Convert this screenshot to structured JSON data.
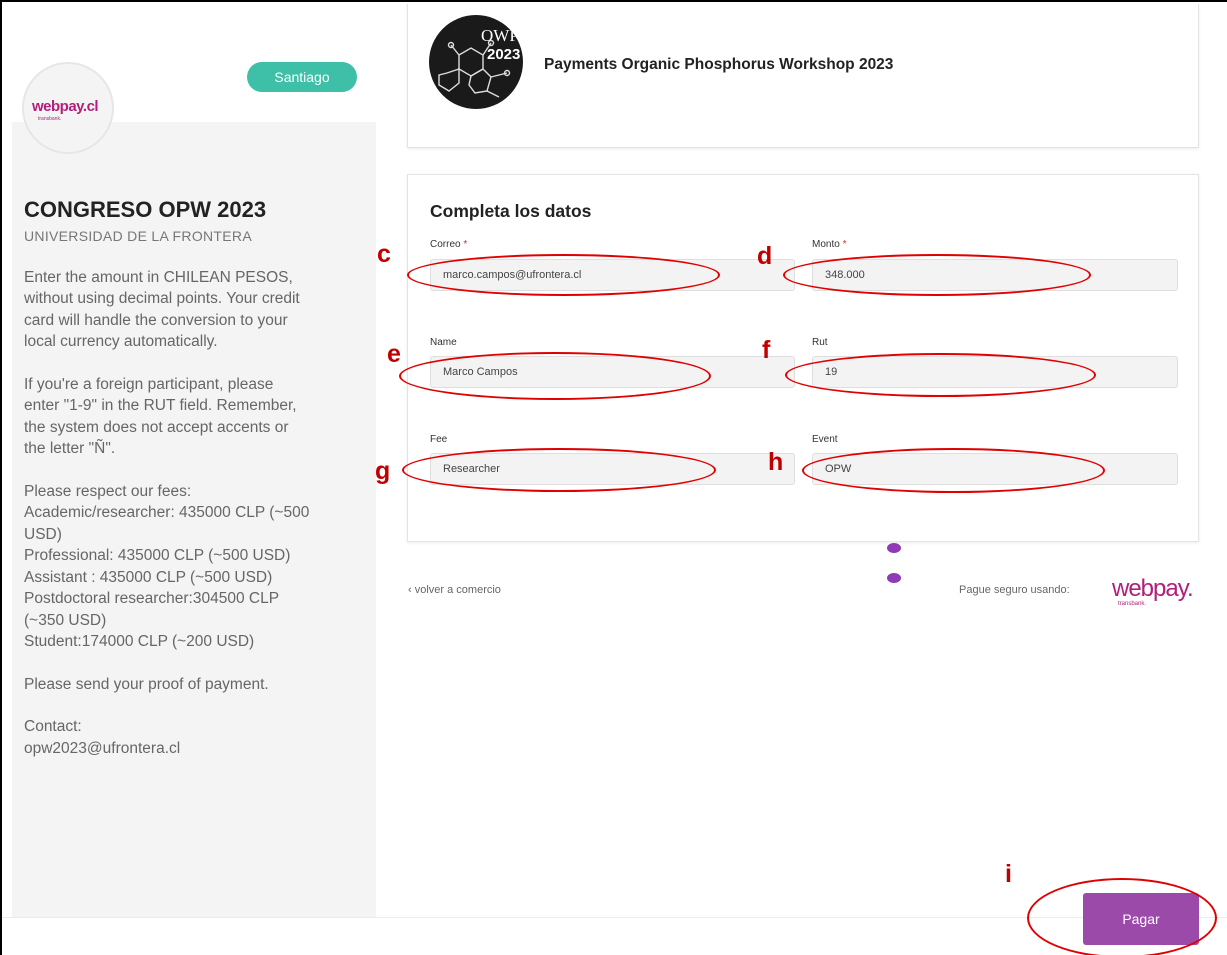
{
  "sidebar": {
    "logo_text": "webpay.cl",
    "logo_subtext": "transbank.",
    "city_badge": "Santiago",
    "title": "CONGRESO OPW 2023",
    "subtitle": "UNIVERSIDAD DE LA FRONTERA",
    "paragraph1": [
      "Enter the amount in CHILEAN PESOS,",
      "without using decimal points. Your credit",
      "card will handle the conversion to your",
      "local currency automatically."
    ],
    "paragraph2": [
      "If you're a foreign participant, please",
      "enter \"1-9\" in the RUT field. Remember,",
      "the system does not accept accents or",
      "the letter \"Ñ\"."
    ],
    "paragraph3": [
      "Please respect our fees:",
      "Academic/researcher: 435000 CLP (~500",
      "USD)",
      "Professional: 435000 CLP (~500 USD)",
      "Assistant : 435000 CLP (~500 USD)",
      "Postdoctoral researcher:304500 CLP",
      "(~350 USD)",
      "Student:174000 CLP (~200 USD)"
    ],
    "paragraph4": [
      "Please send your proof of payment."
    ],
    "paragraph5": [
      "Contact:",
      "opw2023@ufrontera.cl"
    ]
  },
  "header": {
    "event_logo_text": "OWP",
    "event_logo_year": "2023",
    "title": "Payments Organic Phosphorus Workshop 2023"
  },
  "form": {
    "title": "Completa los datos",
    "fields": {
      "correo": {
        "label": "Correo",
        "required_mark": "*",
        "value": "marco.campos@ufrontera.cl"
      },
      "monto": {
        "label": "Monto",
        "required_mark": "*",
        "value": "348.000"
      },
      "name": {
        "label": "Name",
        "value": "Marco Campos"
      },
      "rut": {
        "label": "Rut",
        "value": "19"
      },
      "fee": {
        "label": "Fee",
        "value": "Researcher"
      },
      "event": {
        "label": "Event",
        "value": "OPW"
      }
    }
  },
  "footer_links": {
    "back_link": "‹ volver a comercio",
    "secure_text": "Pague seguro usando:",
    "webpay_logo": "webpay.",
    "webpay_sub": "transbank."
  },
  "pay_button": "Pagar",
  "annotations": {
    "c": "c",
    "d": "d",
    "e": "e",
    "f": "f",
    "g": "g",
    "h": "h",
    "i": "i"
  },
  "colors": {
    "accent_pay": "#9c4aaa",
    "badge": "#3dbfa8",
    "annotation_red": "#e00000",
    "webpay_brand": "#b21f7a"
  }
}
